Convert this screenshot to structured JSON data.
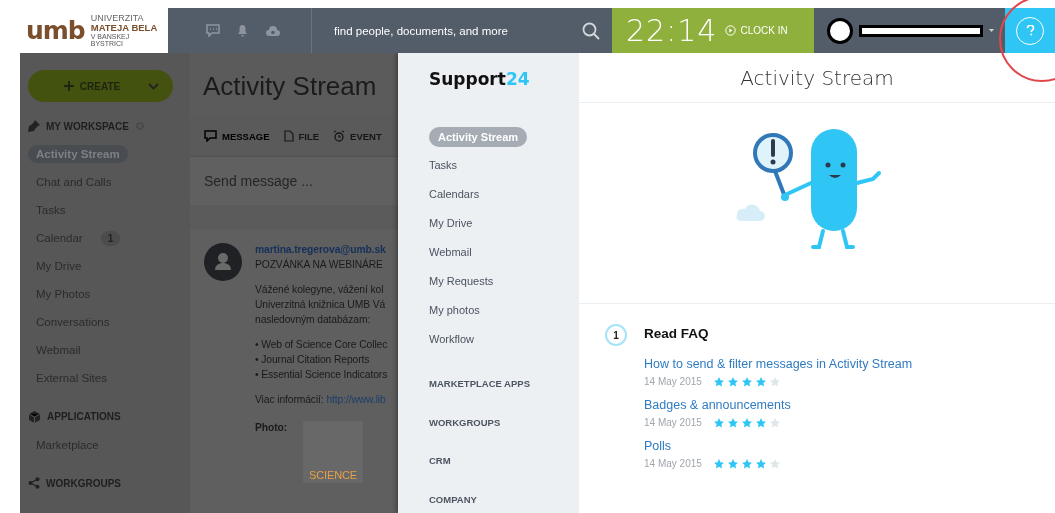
{
  "logo": {
    "mark": "umb",
    "line1": "UNIVERZITA",
    "line2": "MATEJA BELA",
    "line3": "V BANSKEJ BYSTRICI"
  },
  "header": {
    "search_placeholder": "find people, documents, and more",
    "time": "22:14",
    "clock_in": "CLOCK IN"
  },
  "left_sidebar": {
    "create": "CREATE",
    "sections": [
      {
        "kind": "workspace",
        "title": "MY WORKSPACE",
        "items": [
          {
            "label": "Activity Stream",
            "selected": true
          },
          {
            "label": "Chat and Calls",
            "selected": false
          },
          {
            "label": "Tasks",
            "selected": false
          },
          {
            "label": "Calendar",
            "selected": false,
            "badge": "1"
          },
          {
            "label": "My Drive",
            "selected": false
          },
          {
            "label": "My Photos",
            "selected": false
          },
          {
            "label": "Conversations",
            "selected": false
          },
          {
            "label": "Webmail",
            "selected": false
          },
          {
            "label": "External Sites",
            "selected": false
          }
        ]
      },
      {
        "kind": "applications",
        "title": "APPLICATIONS",
        "items": [
          {
            "label": "Marketplace",
            "selected": false
          }
        ]
      },
      {
        "kind": "workgroups",
        "title": "WORKGROUPS"
      }
    ]
  },
  "page_title": "Activity Stream",
  "composer": {
    "tabs": [
      {
        "kind": "message",
        "label": "MESSAGE",
        "selected": true
      },
      {
        "kind": "file",
        "label": "FILE",
        "selected": false
      },
      {
        "kind": "event",
        "label": "EVENT",
        "selected": false
      }
    ],
    "placeholder": "Send message ..."
  },
  "post": {
    "author": "martina.tregerova@umb.sk",
    "subject": "POZVÁNKA NA WEBINÁRE",
    "lines": [
      "Vážené kolegyne, vážení kol",
      "Univerzitná knižnica UMB Vá",
      "nasledovným databázam:"
    ],
    "bullets": [
      "• Web of Science Core Collec",
      "• Journal Citation Reports",
      "• Essential Science Indicators"
    ],
    "more_label": "Viac informácií:",
    "more_link": "http://www.lib",
    "photo_label": "Photo:",
    "photo_text": "SCIENCE"
  },
  "support": {
    "brand": "Support",
    "brand_accent": "24",
    "menu": [
      {
        "label": "Activity Stream",
        "selected": true
      },
      {
        "label": "Tasks",
        "selected": false
      },
      {
        "label": "Calendars",
        "selected": false
      },
      {
        "label": "My Drive",
        "selected": false
      },
      {
        "label": "Webmail",
        "selected": false
      },
      {
        "label": "My Requests",
        "selected": false
      },
      {
        "label": "My photos",
        "selected": false
      },
      {
        "label": "Workflow",
        "selected": false
      }
    ],
    "sections": [
      "MARKETPLACE APPS",
      "WORKGROUPS",
      "CRM",
      "COMPANY"
    ],
    "title": "Activity Stream",
    "step": {
      "number": "1",
      "title": "Read FAQ",
      "articles": [
        {
          "title": "How to send & filter messages in Activity Stream",
          "date": "14 May 2015",
          "stars": 4
        },
        {
          "title": "Badges & announcements",
          "date": "14 May 2015",
          "stars": 4
        },
        {
          "title": "Polls",
          "date": "14 May 2015",
          "stars": 4
        }
      ]
    }
  }
}
